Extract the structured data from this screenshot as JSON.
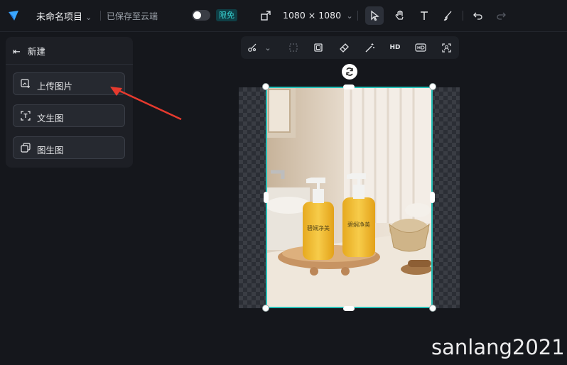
{
  "header": {
    "title": "未命名项目",
    "saved_status": "已保存至云端",
    "free_badge": "限免",
    "canvas_size": "1080 × 1080",
    "logo_icon": "logo-icon"
  },
  "toolbar": {
    "tools": [
      {
        "name": "select-tool",
        "icon": "cursor-icon",
        "active": true
      },
      {
        "name": "hand-tool",
        "icon": "hand-icon",
        "active": false
      },
      {
        "name": "text-tool",
        "icon": "text-icon",
        "active": false
      },
      {
        "name": "brush-tool",
        "icon": "brush-icon",
        "active": false
      },
      {
        "name": "undo",
        "icon": "undo-icon",
        "active": false
      },
      {
        "name": "redo",
        "icon": "redo-icon",
        "active": false
      }
    ]
  },
  "image_toolbar": {
    "hd_label": "HD"
  },
  "panel": {
    "title": "新建",
    "buttons": [
      {
        "label": "上传图片",
        "icon": "upload-image-icon"
      },
      {
        "label": "文生图",
        "icon": "text-to-image-icon"
      },
      {
        "label": "图生图",
        "icon": "image-to-image-icon"
      }
    ]
  },
  "canvas": {
    "product_label": "碧娴净美"
  },
  "watermark": "sanlang2021",
  "colors": {
    "accent": "#27c0b8",
    "badge_text": "#39d3d3",
    "arrow": "#e63a2e"
  }
}
